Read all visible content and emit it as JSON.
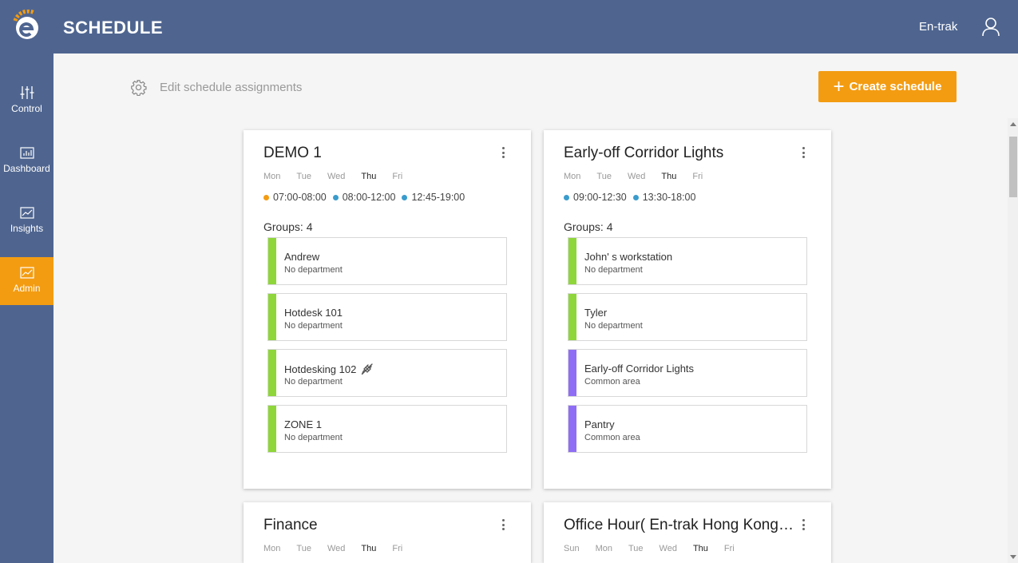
{
  "header": {
    "title": "SCHEDULE",
    "org": "En-trak"
  },
  "sidebar": {
    "items": [
      {
        "label": "Control"
      },
      {
        "label": "Dashboard"
      },
      {
        "label": "Insights"
      },
      {
        "label": "Admin"
      }
    ]
  },
  "toolbar": {
    "edit_label": "Edit schedule assignments",
    "create_label": "Create schedule"
  },
  "colors": {
    "accent": "#f39c12",
    "header": "#4f6590",
    "green": "#8fd63a",
    "purple": "#8f6ef5",
    "dot_orange": "#f39c12",
    "dot_blue": "#3a9ccc"
  },
  "cards": [
    {
      "title": "DEMO 1",
      "days": [
        "Mon",
        "Tue",
        "Wed",
        "Thu",
        "Fri"
      ],
      "slots": [
        {
          "time": "07:00-08:00",
          "color": "orange"
        },
        {
          "time": "08:00-12:00",
          "color": "blue"
        },
        {
          "time": "12:45-19:00",
          "color": "blue"
        }
      ],
      "groups_label": "Groups: 4",
      "groups": [
        {
          "name": "Andrew",
          "dept": "No department",
          "color": "green"
        },
        {
          "name": "Hotdesk 101",
          "dept": "No department",
          "color": "green"
        },
        {
          "name": "Hotdesking 102",
          "dept": "No department",
          "color": "green",
          "icon": "unplug-icon"
        },
        {
          "name": "ZONE 1",
          "dept": "No department",
          "color": "green"
        }
      ]
    },
    {
      "title": "Early-off Corridor Lights",
      "days": [
        "Mon",
        "Tue",
        "Wed",
        "Thu",
        "Fri"
      ],
      "slots": [
        {
          "time": "09:00-12:30",
          "color": "blue"
        },
        {
          "time": "13:30-18:00",
          "color": "blue"
        }
      ],
      "groups_label": "Groups: 4",
      "groups": [
        {
          "name": "John' s workstation",
          "dept": "No department",
          "color": "green"
        },
        {
          "name": "Tyler",
          "dept": "No department",
          "color": "green"
        },
        {
          "name": "Early-off Corridor Lights",
          "dept": "Common area",
          "color": "purple"
        },
        {
          "name": "Pantry",
          "dept": "Common area",
          "color": "purple"
        }
      ]
    },
    {
      "title": "Finance",
      "days": [
        "Mon",
        "Tue",
        "Wed",
        "Thu",
        "Fri"
      ]
    },
    {
      "title": "Office Hour( En-trak Hong Kong…",
      "days": [
        "Sun",
        "Mon",
        "Tue",
        "Wed",
        "Thu",
        "Fri"
      ]
    }
  ]
}
